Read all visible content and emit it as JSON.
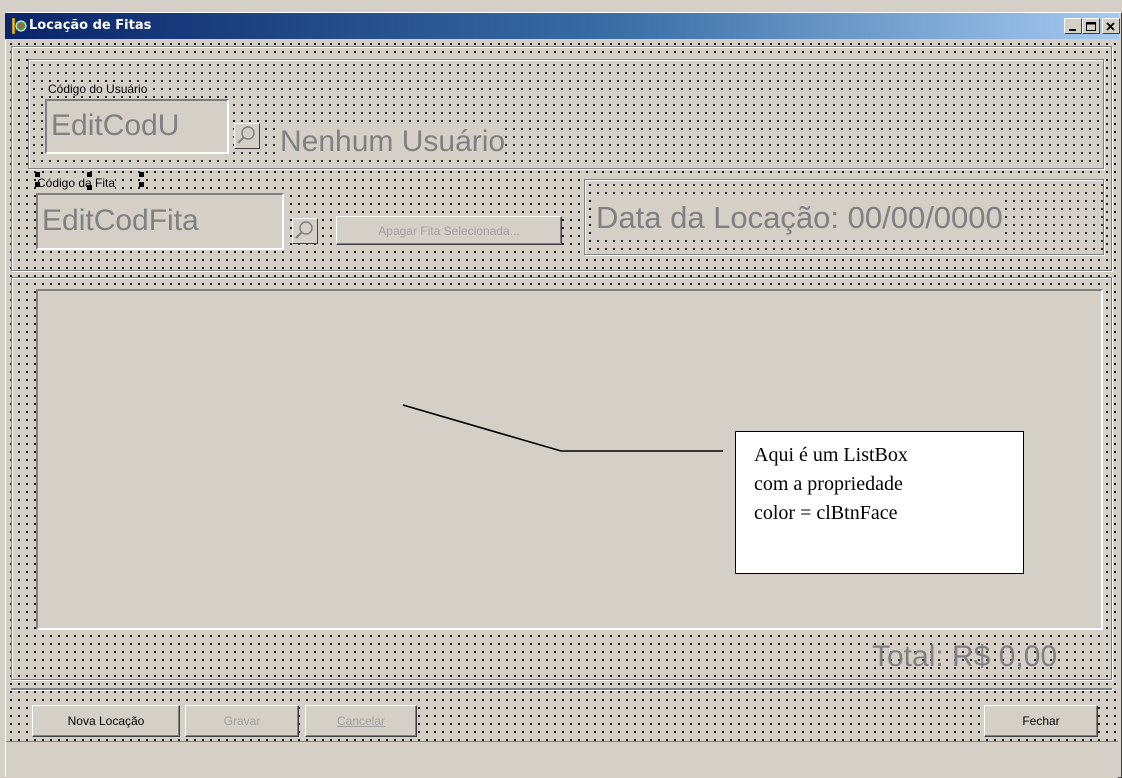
{
  "window": {
    "title": "Locação de Fitas",
    "app_icon": "delphi-app-icon",
    "caption_buttons": [
      "minimize",
      "maximize",
      "close"
    ]
  },
  "user_group": {
    "user_code_label": "Código do Usuário",
    "user_code_edit": "EditCodU",
    "user_name_label": "Nenhum Usuário"
  },
  "tape_group": {
    "tape_code_label": "Código da Fita",
    "tape_code_edit": "EditCodFita",
    "delete_button_label": "Apagar Fita Selecionada..."
  },
  "rental_date_label": "Data da Locação: 00/00/0000",
  "listbox": {
    "annotation": "Aqui é um ListBox com a propriedade color = clBtnFace",
    "annotation_lines": [
      "Aqui é um ListBox",
      "com a propriedade",
      "color = clBtnFace"
    ]
  },
  "total_label": "Total: R$ 0,00",
  "footer": {
    "new_rental_button": "Nova Locação",
    "save_button": "Gravar",
    "cancel_button": "Cancelar",
    "close_button": "Fechar"
  },
  "colors": {
    "btn_face": "#d4d0c8",
    "title_gradient_start": "#0a246a",
    "title_gradient_end": "#a6caf0",
    "disabled_text": "#808080"
  }
}
